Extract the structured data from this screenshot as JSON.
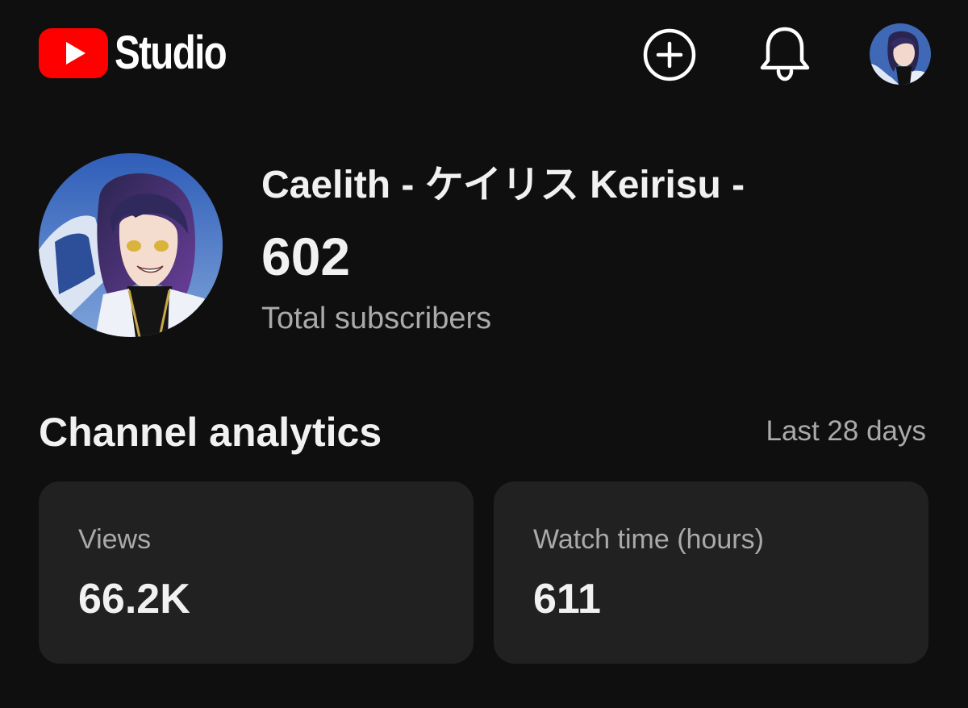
{
  "header": {
    "app_name": "Studio",
    "logo_icon": "youtube-play-logo",
    "create_icon": "plus-circle-icon",
    "notifications_icon": "bell-icon",
    "account_icon": "avatar"
  },
  "channel": {
    "name": "Caelith - ケイリス Keirisu -",
    "subscriber_count": "602",
    "subscriber_label": "Total subscribers"
  },
  "analytics": {
    "title": "Channel analytics",
    "range": "Last 28 days",
    "cards": [
      {
        "label": "Views",
        "value": "66.2K"
      },
      {
        "label": "Watch time (hours)",
        "value": "611"
      }
    ]
  },
  "colors": {
    "background": "#0f0f0f",
    "card": "#212121",
    "brand_red": "#ff0000",
    "text_primary": "#f1f1f1",
    "text_secondary": "#aaaaaa"
  }
}
